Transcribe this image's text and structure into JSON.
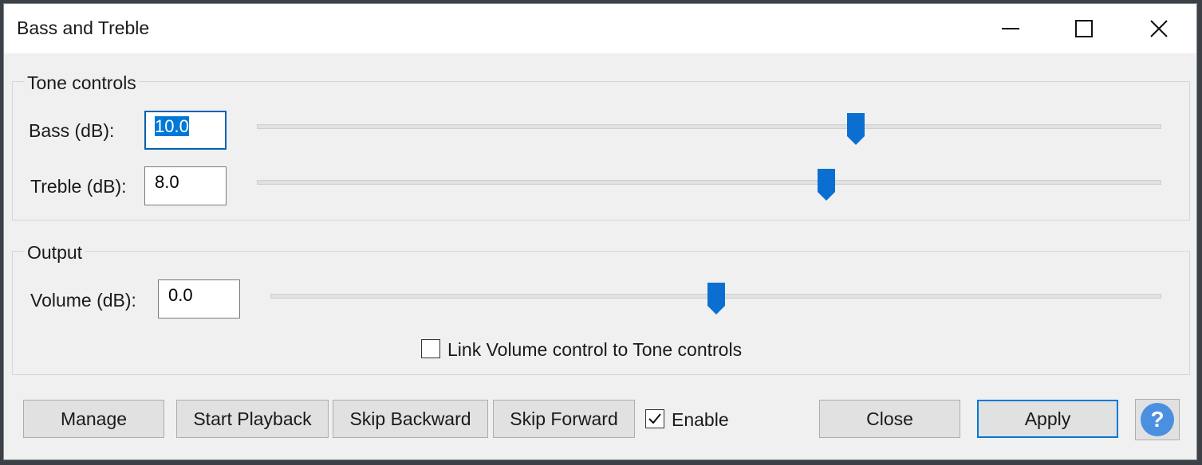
{
  "window": {
    "title": "Bass and Treble",
    "controls": [
      "minimize-icon",
      "maximize-icon",
      "close-icon"
    ]
  },
  "tone_group": {
    "label": "Tone controls",
    "bass": {
      "label": "Bass (dB):",
      "value": "10.0",
      "slider_fraction": 0.66
    },
    "treble": {
      "label": "Treble (dB):",
      "value": "8.0",
      "slider_fraction": 0.63
    }
  },
  "output_group": {
    "label": "Output",
    "volume": {
      "label": "Volume (dB):",
      "value": "0.0",
      "slider_fraction": 0.5
    },
    "link": {
      "label": "Link Volume control to Tone controls",
      "checked": false
    }
  },
  "buttons": {
    "manage": "Manage",
    "start_playback": "Start Playback",
    "skip_backward": "Skip Backward",
    "skip_forward": "Skip Forward",
    "enable": {
      "label": "Enable",
      "checked": true
    },
    "close": "Close",
    "apply": "Apply",
    "help_icon": "help-icon"
  },
  "colors": {
    "accent": "#0078d7",
    "slider_thumb": "#0a6fd1",
    "help": "#4a8fe0"
  }
}
